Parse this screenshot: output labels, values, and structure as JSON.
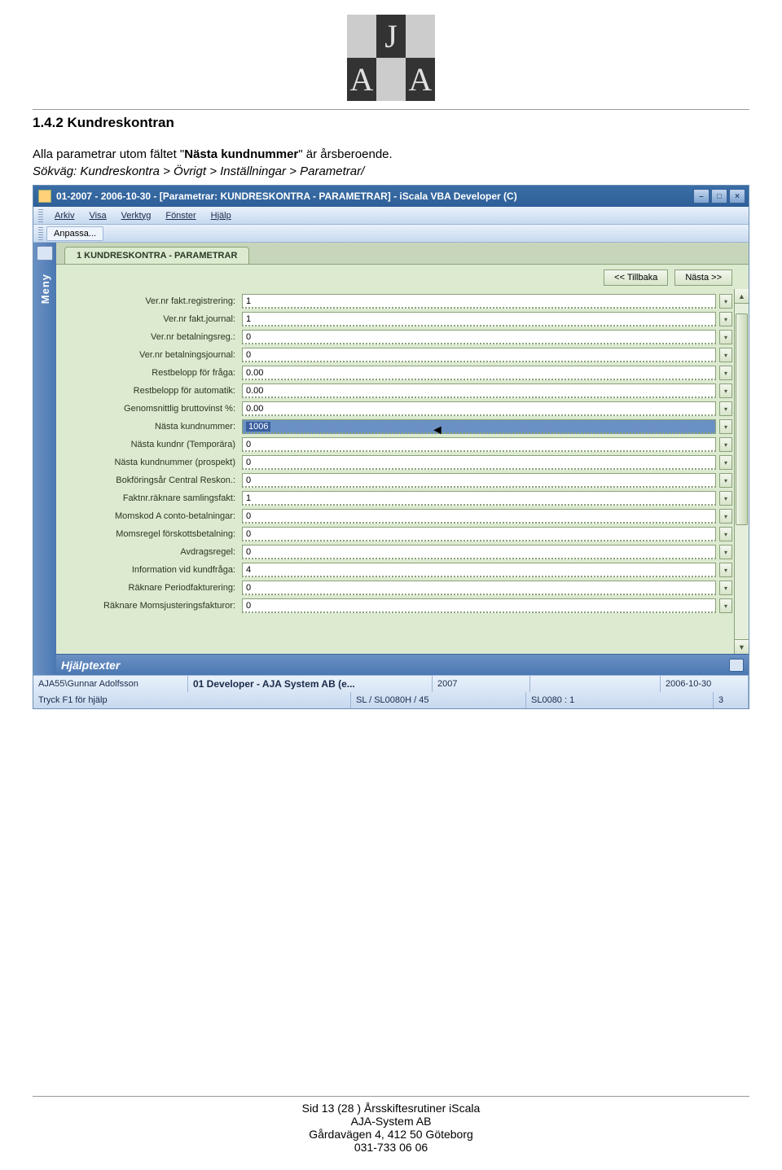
{
  "logo_letters": [
    "A",
    "J",
    "A"
  ],
  "doc": {
    "heading": "1.4.2 Kundreskontran",
    "para_pre": "Alla parametrar utom fältet \"",
    "para_bold": "Nästa kundnummer",
    "para_post": "\" är årsberoende.",
    "path": "Sökväg: Kundreskontra > Övrigt > Inställningar > Parametrar/"
  },
  "window": {
    "title": "01-2007 - 2006-10-30 - [Parametrar: KUNDRESKONTRA - PARAMETRAR] - iScala VBA Developer (C)",
    "menus": [
      "Arkiv",
      "Visa",
      "Verktyg",
      "Fönster",
      "Hjälp"
    ],
    "toolbar_btn": "Anpassa...",
    "meny_label": "Meny",
    "tab_label": "1 KUNDRESKONTRA - PARAMETRAR",
    "nav_back": "<< Tillbaka",
    "nav_next": "Nästa >>",
    "help_title": "Hjälptexter",
    "fields": [
      {
        "label": "Ver.nr fakt.registrering:",
        "value": "1",
        "hl": false
      },
      {
        "label": "Ver.nr fakt.journal:",
        "value": "1",
        "hl": false
      },
      {
        "label": "Ver.nr betalningsreg.:",
        "value": "0",
        "hl": false
      },
      {
        "label": "Ver.nr betalningsjournal:",
        "value": "0",
        "hl": false
      },
      {
        "label": "Restbelopp för fråga:",
        "value": "0.00",
        "hl": false
      },
      {
        "label": "Restbelopp för automatik:",
        "value": "0.00",
        "hl": false
      },
      {
        "label": "Genomsnittlig bruttovinst %:",
        "value": "0.00",
        "hl": false
      },
      {
        "label": "Nästa kundnummer:",
        "value": "1006",
        "hl": true
      },
      {
        "label": "Nästa kundnr (Temporära)",
        "value": "0",
        "hl": false
      },
      {
        "label": "Nästa kundnummer (prospekt)",
        "value": "0",
        "hl": false
      },
      {
        "label": "Bokföringsår Central Reskon.:",
        "value": "0",
        "hl": false
      },
      {
        "label": "Faktnr.räknare samlingsfakt:",
        "value": "1",
        "hl": false
      },
      {
        "label": "Momskod A conto-betalningar:",
        "value": "0",
        "hl": false
      },
      {
        "label": "Momsregel förskottsbetalning:",
        "value": "0",
        "hl": false
      },
      {
        "label": "Avdragsregel:",
        "value": "0",
        "hl": false
      },
      {
        "label": "Information vid kundfråga:",
        "value": "4",
        "hl": false
      },
      {
        "label": "Räknare Periodfakturering:",
        "value": "0",
        "hl": false
      },
      {
        "label": "Räknare Momsjusteringsfakturor:",
        "value": "0",
        "hl": false
      }
    ],
    "status1": {
      "a": "AJA55\\Gunnar Adolfsson",
      "b": "01 Developer - AJA System AB (e...",
      "c": "2007",
      "d": "",
      "e": "2006-10-30"
    },
    "status2": {
      "a": "Tryck F1 för hjälp",
      "b": "SL / SL0080H / 45",
      "c": "SL0080 : 1",
      "d": "3"
    }
  },
  "arrow": "◄",
  "footer": {
    "l1": "Sid 13 (28 ) Årsskiftesrutiner iScala",
    "l2": "AJA-System AB",
    "l3": "Gårdavägen 4, 412 50 Göteborg",
    "l4": "031-733 06 06"
  }
}
